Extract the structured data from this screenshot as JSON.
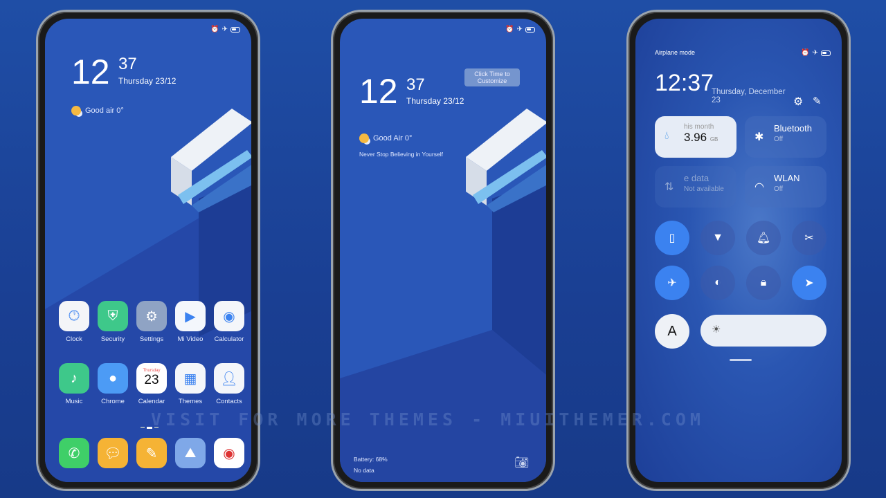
{
  "home": {
    "hour": "12",
    "minute": "37",
    "date": "Thursday 23/12",
    "weather": "Good air 0°",
    "apps": [
      {
        "label": "Clock",
        "icon": "clock-icon",
        "color": "#f4f5f8"
      },
      {
        "label": "Security",
        "icon": "shield-icon",
        "color": "#3ec88a"
      },
      {
        "label": "Settings",
        "icon": "gear-icon",
        "color": "#8fa3c4"
      },
      {
        "label": "Mi Video",
        "icon": "play-icon",
        "color": "#f4f7fc"
      },
      {
        "label": "Calculator",
        "icon": "calculator-icon",
        "color": "#f4f6fa"
      },
      {
        "label": "Music",
        "icon": "music-note-icon",
        "color": "#3ec88a"
      },
      {
        "label": "Chrome",
        "icon": "planet-icon",
        "color": "#4c9bf5"
      },
      {
        "label": "Calendar",
        "icon": "calendar-icon",
        "color": "#ffffff",
        "day": "Thursday",
        "num": "23"
      },
      {
        "label": "Themes",
        "icon": "themes-icon",
        "color": "#f4f6fa"
      },
      {
        "label": "Contacts",
        "icon": "person-icon",
        "color": "#f4f6fa"
      }
    ],
    "dock": [
      {
        "icon": "phone-icon",
        "color": "#3fcf68"
      },
      {
        "icon": "message-icon",
        "color": "#f5b335"
      },
      {
        "icon": "notes-icon",
        "color": "#f5b335"
      },
      {
        "icon": "gallery-icon",
        "color": "#7fa8e8"
      },
      {
        "icon": "camera-icon",
        "color": "#ffffff"
      }
    ]
  },
  "lock": {
    "hour": "12",
    "minute": "37",
    "date": "Thursday 23/12",
    "tooltip": "Click Time to Customize",
    "weather": "Good Air 0°",
    "motto": "Never Stop Believing in Yourself",
    "battery": "Battery: 68%",
    "data": "No data"
  },
  "control": {
    "mode": "Airplane mode",
    "time": "12:37",
    "date": "Thursday, December 23",
    "tiles": [
      {
        "title": "3.96",
        "unit": "GB",
        "sub": "his month",
        "icon": "water-drop-icon"
      },
      {
        "title": "Bluetooth",
        "sub": "Off",
        "icon": "bluetooth-icon"
      },
      {
        "title": "e data",
        "sub": "Not available",
        "icon": "mobile-data-icon"
      },
      {
        "title": "WLAN",
        "sub": "Off",
        "icon": "wifi-icon"
      }
    ],
    "toggles": [
      {
        "icon": "vibrate-icon",
        "on": true
      },
      {
        "icon": "flashlight-icon",
        "on": false
      },
      {
        "icon": "bell-icon",
        "on": false
      },
      {
        "icon": "screenshot-icon",
        "on": false
      },
      {
        "icon": "airplane-icon",
        "on": true
      },
      {
        "icon": "contrast-icon",
        "on": false
      },
      {
        "icon": "lock-icon",
        "on": false
      },
      {
        "icon": "location-icon",
        "on": true
      }
    ],
    "auto_brightness": "A"
  },
  "watermark": "VISIT FOR MORE THEMES - MIUITHEMER.COM"
}
